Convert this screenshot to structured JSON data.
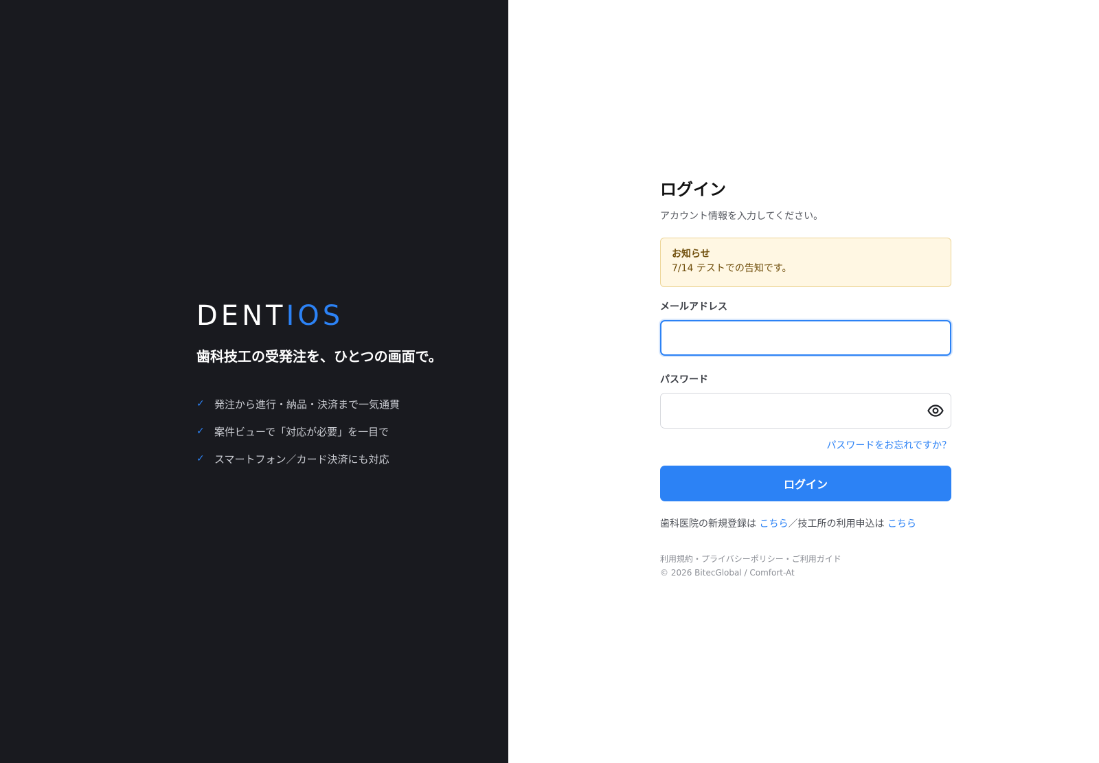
{
  "brand": {
    "logo_part1": "DENT",
    "logo_part2": "IOS",
    "tagline": "歯科技工の受発注を、ひとつの画面で。",
    "features": [
      "発注から進行・納品・決済まで一気通貫",
      "案件ビューで「対応が必要」を一目で",
      "スマートフォン／カード決済にも対応"
    ],
    "check_icon": "check-icon"
  },
  "login": {
    "title": "ログイン",
    "subtitle": "アカウント情報を入力してください。",
    "notice": {
      "title": "お知らせ",
      "body": "7/14 テストでの告知です。"
    },
    "email": {
      "label": "メールアドレス",
      "value": "",
      "placeholder": ""
    },
    "password": {
      "label": "パスワード",
      "value": "",
      "placeholder": "",
      "toggle_icon": "eye-icon"
    },
    "forgot_link": "パスワードをお忘れですか？",
    "submit_label": "ログイン",
    "register": {
      "clinic_text": "歯科医院の新規登録は",
      "clinic_link": "こちら",
      "separator_text": "／技工所の利用申込は",
      "lab_link": "こちら"
    },
    "footer": {
      "links": "利用規約・プライバシーポリシー・ご利用ガイド",
      "copyright": "© 2026 BitecGlobal / Comfort-At"
    }
  },
  "colors": {
    "left_background": "#191a1f",
    "accent": "#2c82f5",
    "notice_background": "#fff7e3",
    "notice_border": "#ecd496",
    "notice_text": "#6f4e0b"
  }
}
